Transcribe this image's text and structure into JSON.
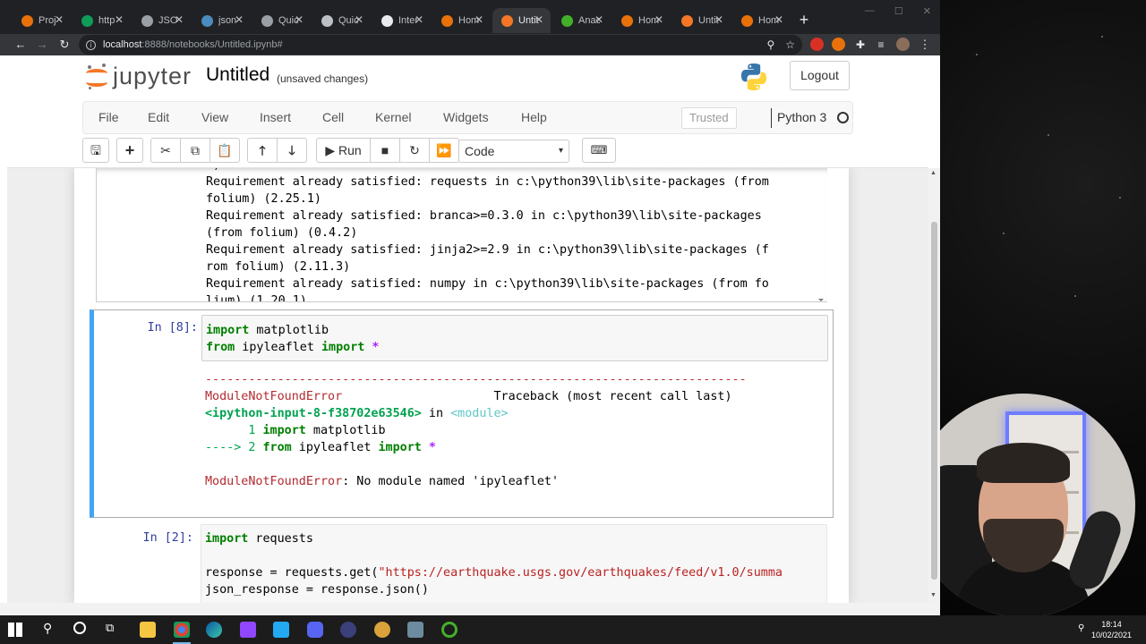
{
  "browser": {
    "tabs": [
      {
        "label": "Proj",
        "color": "#e8710a"
      },
      {
        "label": "http",
        "color": "#0f9d58"
      },
      {
        "label": "JSO",
        "color": "#9aa0a6"
      },
      {
        "label": "json",
        "color": "#4b8bbe"
      },
      {
        "label": "Quic",
        "color": "#9aa0a6"
      },
      {
        "label": "Quic",
        "color": "#bdc1c6"
      },
      {
        "label": "Inter",
        "color": "#e8eaed"
      },
      {
        "label": "Hom",
        "color": "#e8710a"
      },
      {
        "label": "Untit",
        "color": "#f37726"
      },
      {
        "label": "Anac",
        "color": "#43b02a"
      },
      {
        "label": "Hom",
        "color": "#e8710a"
      },
      {
        "label": "Untit",
        "color": "#f37726"
      },
      {
        "label": "Hom",
        "color": "#e8710a"
      }
    ],
    "close_glyph": "✕",
    "new_tab": "+",
    "url_host": "localhost",
    "url_rest": ":8888/notebooks/Untitled.ipynb#"
  },
  "jupyter": {
    "logo_text": "jupyter",
    "notebook_title": "Untitled",
    "save_status": "(unsaved changes)",
    "logout_label": "Logout",
    "menu": [
      "File",
      "Edit",
      "View",
      "Insert",
      "Cell",
      "Kernel",
      "Widgets",
      "Help"
    ],
    "trusted_label": "Trusted",
    "kernel_name": "Python 3",
    "run_label": "Run",
    "cell_type": "Code"
  },
  "notebook": {
    "prev_output": [
      "1)",
      "Requirement already satisfied: requests in c:\\python39\\lib\\site-packages (from",
      "folium) (2.25.1)",
      "Requirement already satisfied: branca>=0.3.0 in c:\\python39\\lib\\site-packages",
      "(from folium) (0.4.2)",
      "Requirement already satisfied: jinja2>=2.9 in c:\\python39\\lib\\site-packages (f",
      "rom folium) (2.11.3)",
      "Requirement already satisfied: numpy in c:\\python39\\lib\\site-packages (from fo",
      "lium) (1.20.1)"
    ],
    "cell8": {
      "prompt": "In [8]:",
      "line1_kw": "import",
      "line1_rest": " matplotlib",
      "line2_kw": "from",
      "line2_mid": " ipyleaflet ",
      "line2_kw2": "import",
      "line2_op": " *",
      "dashes": "---------------------------------------------------------------------------",
      "err_name": "ModuleNotFoundError",
      "traceback": "Traceback (most recent call last)",
      "input_ref": "<ipython-input-8-f38702e63546>",
      "in_word": " in ",
      "module_ref": "<module>",
      "tb_line1_num": "      1 ",
      "tb_line1_kw": "import",
      "tb_line1_rest": " matplotlib",
      "tb_arrow": "----> 2 ",
      "tb_line2_kw": "from",
      "tb_line2_mid": " ipyleaflet ",
      "tb_line2_kw2": "import",
      "tb_line2_op": " *",
      "err_msg": ": No module named 'ipyleaflet'"
    },
    "cell2": {
      "prompt": "In [2]:",
      "line1_kw": "import",
      "line1_rest": " requests",
      "line3_a": "response = requests.get(",
      "line3_str": "\"https://earthquake.usgs.gov/earthquakes/feed/v1.0/summa",
      "line4": "json_response = response.json()"
    }
  },
  "taskbar": {
    "time": "18:14",
    "date": "10/02/2021"
  }
}
